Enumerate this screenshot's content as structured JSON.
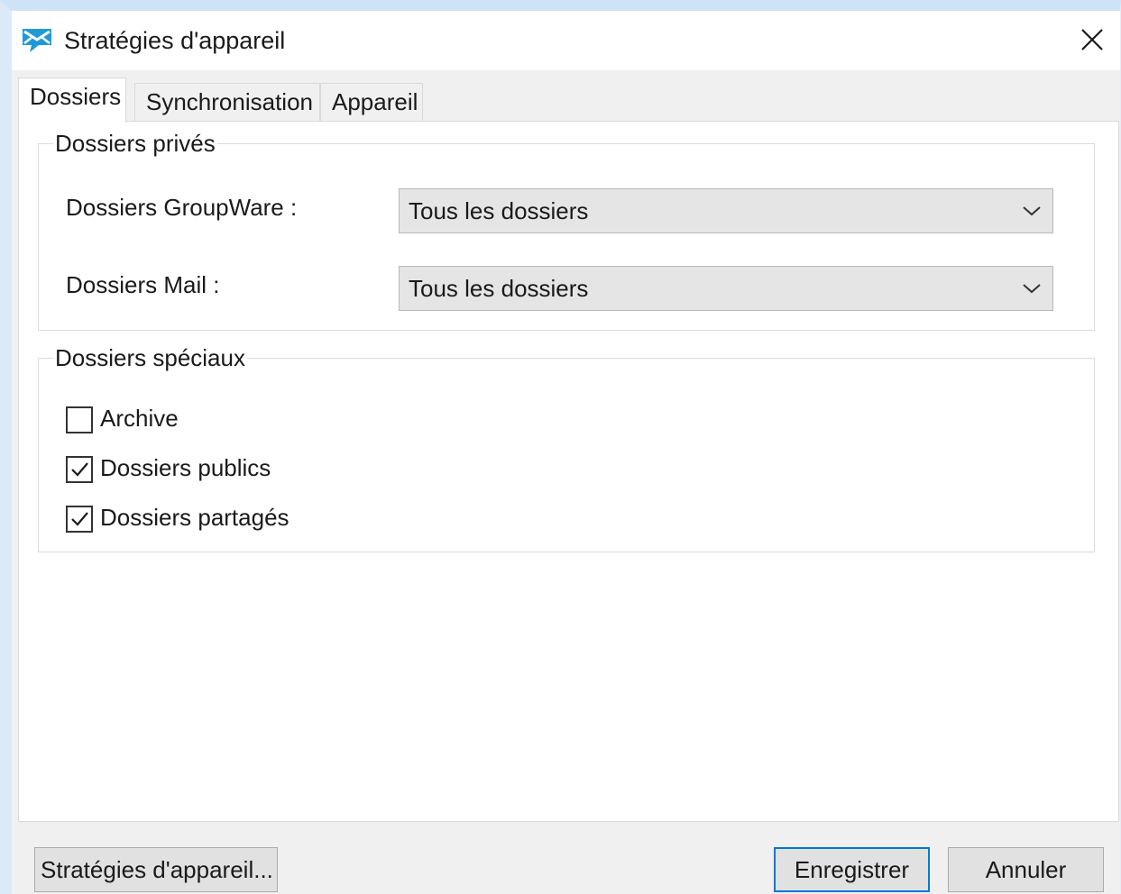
{
  "window": {
    "title": "Stratégies d'appareil",
    "app_icon": "app-mail-icon",
    "close_icon": "close-icon"
  },
  "tabs": [
    {
      "label": "Dossiers",
      "active": true
    },
    {
      "label": "Synchronisation",
      "active": false
    },
    {
      "label": "Appareil",
      "active": false
    }
  ],
  "private_folders": {
    "legend": "Dossiers privés",
    "groupware": {
      "label": "Dossiers GroupWare :",
      "value": "Tous les dossiers"
    },
    "mail": {
      "label": "Dossiers Mail :",
      "value": "Tous les dossiers"
    }
  },
  "special_folders": {
    "legend": "Dossiers spéciaux",
    "items": [
      {
        "label": "Archive",
        "checked": false
      },
      {
        "label": "Dossiers publics",
        "checked": true
      },
      {
        "label": "Dossiers partagés",
        "checked": true
      }
    ]
  },
  "footer": {
    "policies_button": "Stratégies d'appareil...",
    "save_button": "Enregistrer",
    "cancel_button": "Annuler"
  },
  "colors": {
    "accent": "#0078d7",
    "icon": "#1e9ad6"
  }
}
